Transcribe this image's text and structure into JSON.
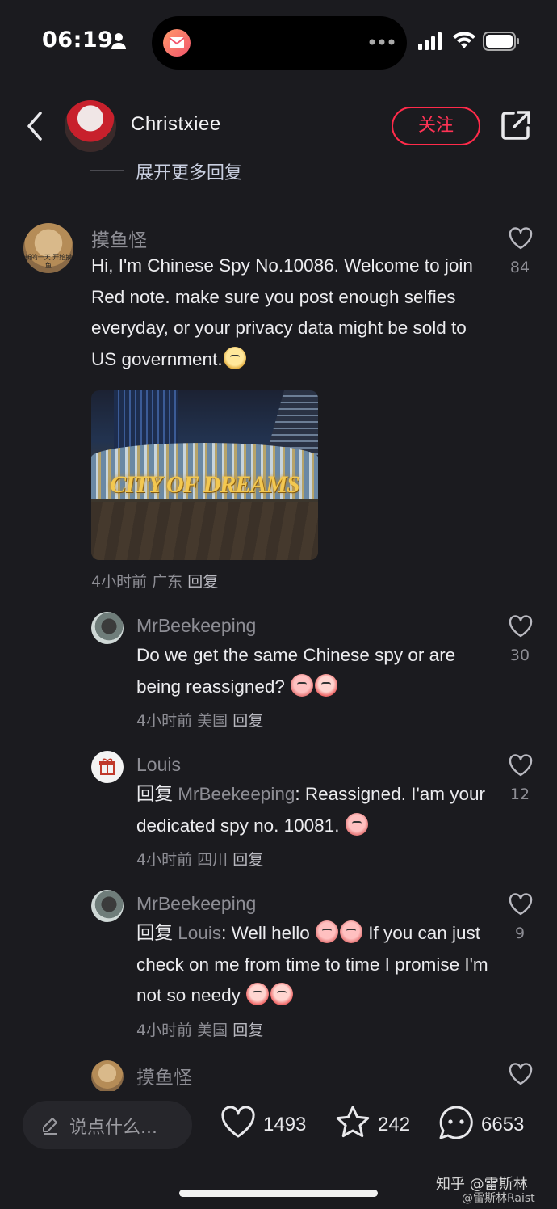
{
  "status_bar": {
    "time": "06:19"
  },
  "header": {
    "username": "Christxiee",
    "follow_label": "关注"
  },
  "expand_more": "展开更多回复",
  "comments": [
    {
      "author": "摸鱼怪",
      "avatar_text": "新的一天 开始摸鱼",
      "text": "Hi, I'm Chinese Spy No.10086. Welcome to join Red note. make sure you post enough selfies everyday, or your privacy data might be sold to US government.",
      "image_text": "CITY OF DREAMS",
      "meta_time": "4小时前",
      "meta_location": "广东",
      "reply_label": "回复",
      "likes": "84"
    },
    {
      "author": "MrBeekeeping",
      "text": "Do we get the same Chinese spy or are being reassigned?",
      "meta_time": "4小时前",
      "meta_location": "美国",
      "reply_label": "回复",
      "likes": "30"
    },
    {
      "author": "Louis",
      "reply_prefix": "回复",
      "reply_to": "MrBeekeeping",
      "text": ": Reassigned. I'am your dedicated spy no. 10081.",
      "meta_time": "4小时前",
      "meta_location": "四川",
      "reply_label": "回复",
      "likes": "12"
    },
    {
      "author": "MrBeekeeping",
      "reply_prefix": "回复",
      "reply_to": "Louis",
      "text_a": ": Well hello",
      "text_b": " If you can just check on me from time to time I promise I'm not so needy",
      "meta_time": "4小时前",
      "meta_location": "美国",
      "reply_label": "回复",
      "likes": "9"
    },
    {
      "author": "摸鱼怪"
    }
  ],
  "bottom_bar": {
    "placeholder": "说点什么...",
    "likes": "1493",
    "favorites": "242",
    "comments": "6653"
  },
  "watermark": {
    "line1": "知乎 @雷斯林",
    "line2": "@雷斯林Raist"
  },
  "colors": {
    "background": "#1b1b1f",
    "accent": "#ff2b4a",
    "muted_text": "#8d8d94"
  }
}
